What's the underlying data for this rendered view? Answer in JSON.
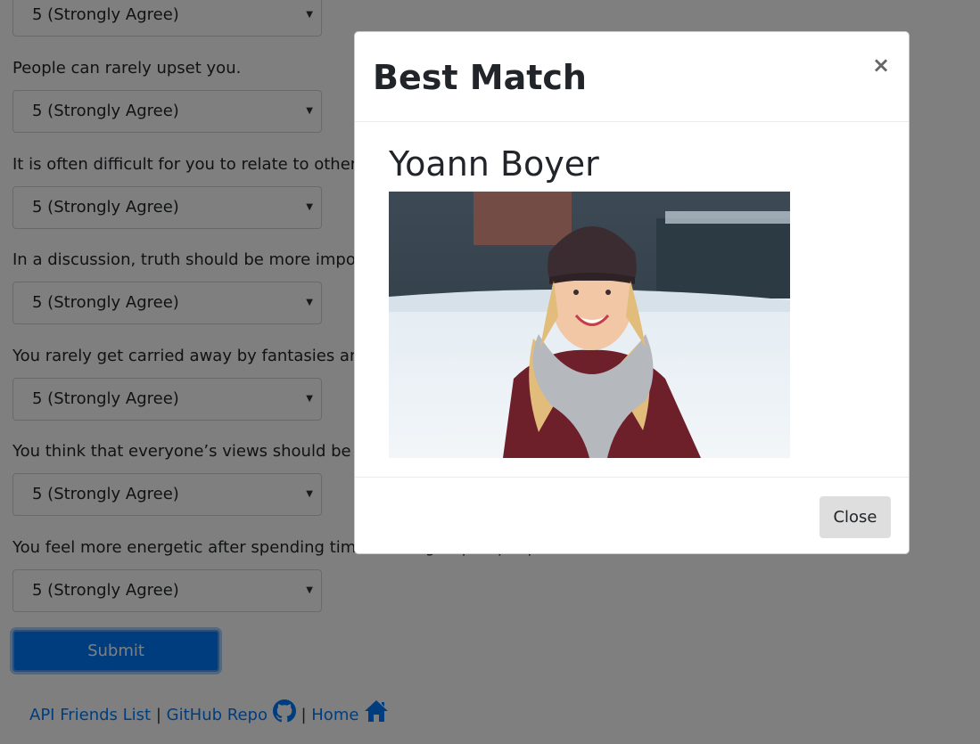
{
  "survey": {
    "questions": [
      {
        "text": "People can rarely upset you.",
        "answer": "5 (Strongly Agree)"
      },
      {
        "text": "It is often difficult for you to relate to other people's feelings.",
        "answer": "5 (Strongly Agree)"
      },
      {
        "text": "In a discussion, truth should be more important than people's sensitivities.",
        "answer": "5 (Strongly Agree)"
      },
      {
        "text": "You rarely get carried away by fantasies and ideas.",
        "answer": "5 (Strongly Agree)"
      },
      {
        "text": "You think that everyone’s views should be respected regardless of whether they are supported by facts or not.",
        "answer": "5 (Strongly Agree)"
      },
      {
        "text": "You feel more energetic after spending time with a group of people.",
        "answer": "5 (Strongly Agree)"
      }
    ],
    "top_select_answer": "5 (Strongly Agree)",
    "submit_label": "Submit"
  },
  "footer": {
    "api_link": "API Friends List",
    "separator1": "|",
    "github_link": "GitHub Repo",
    "separator2": "|",
    "home_link": "Home"
  },
  "modal": {
    "title": "Best Match",
    "close_x": "×",
    "match_name": "Yoann Boyer",
    "close_label": "Close"
  },
  "icons": {
    "select_caret": "caret-down-icon",
    "github": "github-icon",
    "home": "home-icon",
    "close": "close-icon"
  },
  "colors": {
    "primary": "#007bff",
    "backdrop": "rgba(0,0,0,0.5)",
    "close_button_bg": "#dedede"
  }
}
